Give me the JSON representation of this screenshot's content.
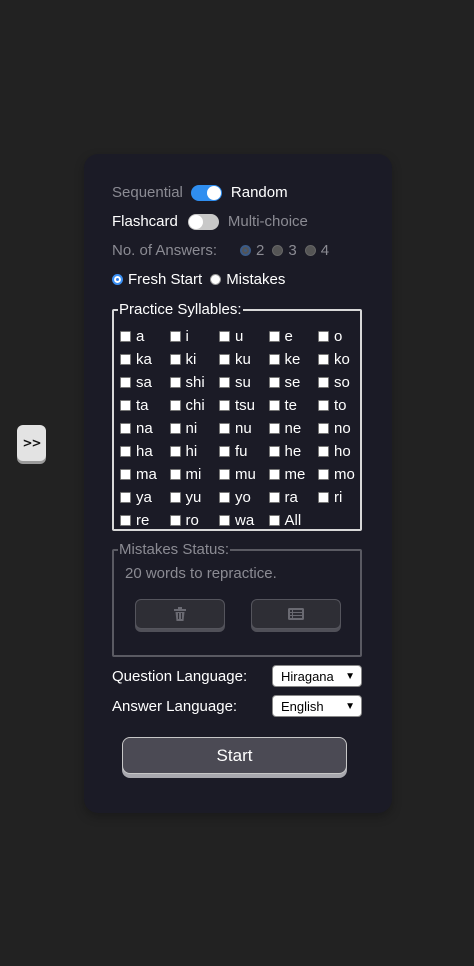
{
  "sidebar_toggle": {
    "label": ">>"
  },
  "mode": {
    "left": "Sequential",
    "right": "Random",
    "on": true
  },
  "type": {
    "left": "Flashcard",
    "right": "Multi-choice",
    "on": false
  },
  "answers": {
    "label": "No. of Answers:",
    "options": [
      "2",
      "3",
      "4"
    ],
    "selected": "2"
  },
  "start_mode": {
    "options": [
      "Fresh Start",
      "Mistakes"
    ],
    "selected": "Fresh Start"
  },
  "syllables": {
    "legend": "Practice Syllables:",
    "items": [
      "a",
      "i",
      "u",
      "e",
      "o",
      "ka",
      "ki",
      "ku",
      "ke",
      "ko",
      "sa",
      "shi",
      "su",
      "se",
      "so",
      "ta",
      "chi",
      "tsu",
      "te",
      "to",
      "na",
      "ni",
      "nu",
      "ne",
      "no",
      "ha",
      "hi",
      "fu",
      "he",
      "ho",
      "ma",
      "mi",
      "mu",
      "me",
      "mo",
      "ya",
      "yu",
      "yo",
      "ra",
      "ri",
      "re",
      "ro",
      "wa",
      "All"
    ]
  },
  "mistakes": {
    "legend": "Mistakes Status:",
    "text": "20 words to repractice.",
    "icons": [
      "trash-icon",
      "list-icon"
    ]
  },
  "question_language": {
    "label": "Question Language:",
    "value": "Hiragana"
  },
  "answer_language": {
    "label": "Answer Language:",
    "value": "English"
  },
  "start_button": {
    "label": "Start"
  }
}
